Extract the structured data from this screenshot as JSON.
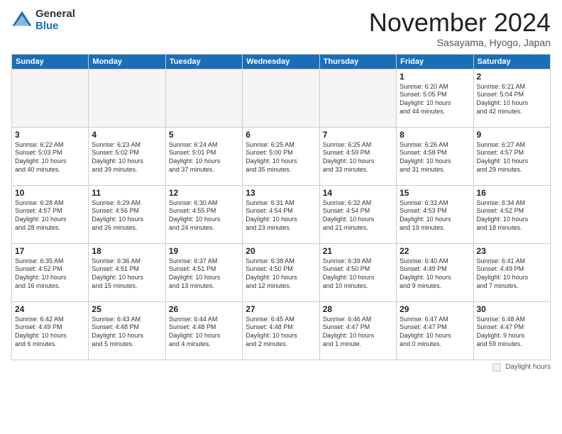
{
  "logo": {
    "general": "General",
    "blue": "Blue"
  },
  "title": {
    "month": "November 2024",
    "location": "Sasayama, Hyogo, Japan"
  },
  "weekdays": [
    "Sunday",
    "Monday",
    "Tuesday",
    "Wednesday",
    "Thursday",
    "Friday",
    "Saturday"
  ],
  "weeks": [
    [
      {
        "day": "",
        "info": ""
      },
      {
        "day": "",
        "info": ""
      },
      {
        "day": "",
        "info": ""
      },
      {
        "day": "",
        "info": ""
      },
      {
        "day": "",
        "info": ""
      },
      {
        "day": "1",
        "info": "Sunrise: 6:20 AM\nSunset: 5:05 PM\nDaylight: 10 hours\nand 44 minutes."
      },
      {
        "day": "2",
        "info": "Sunrise: 6:21 AM\nSunset: 5:04 PM\nDaylight: 10 hours\nand 42 minutes."
      }
    ],
    [
      {
        "day": "3",
        "info": "Sunrise: 6:22 AM\nSunset: 5:03 PM\nDaylight: 10 hours\nand 40 minutes."
      },
      {
        "day": "4",
        "info": "Sunrise: 6:23 AM\nSunset: 5:02 PM\nDaylight: 10 hours\nand 39 minutes."
      },
      {
        "day": "5",
        "info": "Sunrise: 6:24 AM\nSunset: 5:01 PM\nDaylight: 10 hours\nand 37 minutes."
      },
      {
        "day": "6",
        "info": "Sunrise: 6:25 AM\nSunset: 5:00 PM\nDaylight: 10 hours\nand 35 minutes."
      },
      {
        "day": "7",
        "info": "Sunrise: 6:25 AM\nSunset: 4:59 PM\nDaylight: 10 hours\nand 33 minutes."
      },
      {
        "day": "8",
        "info": "Sunrise: 6:26 AM\nSunset: 4:58 PM\nDaylight: 10 hours\nand 31 minutes."
      },
      {
        "day": "9",
        "info": "Sunrise: 6:27 AM\nSunset: 4:57 PM\nDaylight: 10 hours\nand 29 minutes."
      }
    ],
    [
      {
        "day": "10",
        "info": "Sunrise: 6:28 AM\nSunset: 4:57 PM\nDaylight: 10 hours\nand 28 minutes."
      },
      {
        "day": "11",
        "info": "Sunrise: 6:29 AM\nSunset: 4:56 PM\nDaylight: 10 hours\nand 26 minutes."
      },
      {
        "day": "12",
        "info": "Sunrise: 6:30 AM\nSunset: 4:55 PM\nDaylight: 10 hours\nand 24 minutes."
      },
      {
        "day": "13",
        "info": "Sunrise: 6:31 AM\nSunset: 4:54 PM\nDaylight: 10 hours\nand 23 minutes."
      },
      {
        "day": "14",
        "info": "Sunrise: 6:32 AM\nSunset: 4:54 PM\nDaylight: 10 hours\nand 21 minutes."
      },
      {
        "day": "15",
        "info": "Sunrise: 6:33 AM\nSunset: 4:53 PM\nDaylight: 10 hours\nand 19 minutes."
      },
      {
        "day": "16",
        "info": "Sunrise: 6:34 AM\nSunset: 4:52 PM\nDaylight: 10 hours\nand 18 minutes."
      }
    ],
    [
      {
        "day": "17",
        "info": "Sunrise: 6:35 AM\nSunset: 4:52 PM\nDaylight: 10 hours\nand 16 minutes."
      },
      {
        "day": "18",
        "info": "Sunrise: 6:36 AM\nSunset: 4:51 PM\nDaylight: 10 hours\nand 15 minutes."
      },
      {
        "day": "19",
        "info": "Sunrise: 6:37 AM\nSunset: 4:51 PM\nDaylight: 10 hours\nand 13 minutes."
      },
      {
        "day": "20",
        "info": "Sunrise: 6:38 AM\nSunset: 4:50 PM\nDaylight: 10 hours\nand 12 minutes."
      },
      {
        "day": "21",
        "info": "Sunrise: 6:39 AM\nSunset: 4:50 PM\nDaylight: 10 hours\nand 10 minutes."
      },
      {
        "day": "22",
        "info": "Sunrise: 6:40 AM\nSunset: 4:49 PM\nDaylight: 10 hours\nand 9 minutes."
      },
      {
        "day": "23",
        "info": "Sunrise: 6:41 AM\nSunset: 4:49 PM\nDaylight: 10 hours\nand 7 minutes."
      }
    ],
    [
      {
        "day": "24",
        "info": "Sunrise: 6:42 AM\nSunset: 4:49 PM\nDaylight: 10 hours\nand 6 minutes."
      },
      {
        "day": "25",
        "info": "Sunrise: 6:43 AM\nSunset: 4:48 PM\nDaylight: 10 hours\nand 5 minutes."
      },
      {
        "day": "26",
        "info": "Sunrise: 6:44 AM\nSunset: 4:48 PM\nDaylight: 10 hours\nand 4 minutes."
      },
      {
        "day": "27",
        "info": "Sunrise: 6:45 AM\nSunset: 4:48 PM\nDaylight: 10 hours\nand 2 minutes."
      },
      {
        "day": "28",
        "info": "Sunrise: 6:46 AM\nSunset: 4:47 PM\nDaylight: 10 hours\nand 1 minute."
      },
      {
        "day": "29",
        "info": "Sunrise: 6:47 AM\nSunset: 4:47 PM\nDaylight: 10 hours\nand 0 minutes."
      },
      {
        "day": "30",
        "info": "Sunrise: 6:48 AM\nSunset: 4:47 PM\nDaylight: 9 hours\nand 59 minutes."
      }
    ]
  ],
  "legend": {
    "label": "Daylight hours"
  }
}
